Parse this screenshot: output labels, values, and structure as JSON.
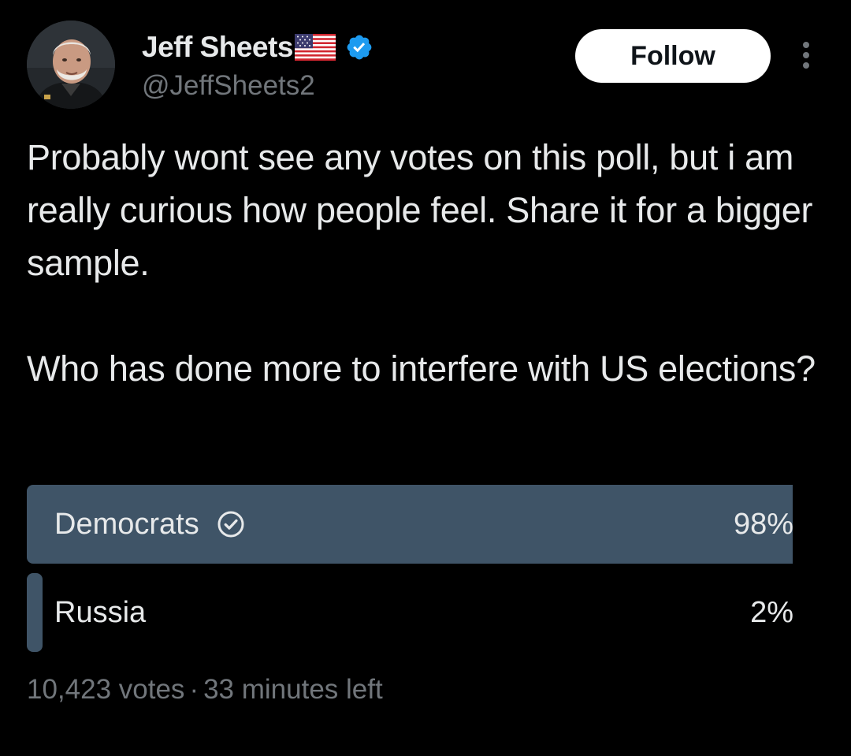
{
  "author": {
    "display_name": "Jeff Sheets",
    "handle": "@JeffSheets2",
    "flag_icon": "us-flag-emoji",
    "verified_icon": "verified-badge-icon",
    "verified_color": "#1d9bf0"
  },
  "follow_button": {
    "label": "Follow"
  },
  "more_icon": "more-vertical-icon",
  "tweet": {
    "paragraph_1": "Probably wont see any votes on this poll, but i am really curious how people feel. Share it for a bigger sample.",
    "paragraph_2": "Who has done more to interfere with US elections?"
  },
  "poll": {
    "options": [
      {
        "label": "Democrats",
        "percent_label": "98%",
        "share": 0.98,
        "winner": true,
        "icon": "check-circle-icon"
      },
      {
        "label": "Russia",
        "percent_label": "2%",
        "share": 0.02,
        "winner": false
      }
    ],
    "votes": "10,423 votes",
    "separator": "·",
    "time_left": "33 minutes left",
    "bar_color": "#3f5467"
  },
  "colors": {
    "background": "#000000",
    "primary_text": "#e7e9ea",
    "secondary_text": "#71767b"
  }
}
